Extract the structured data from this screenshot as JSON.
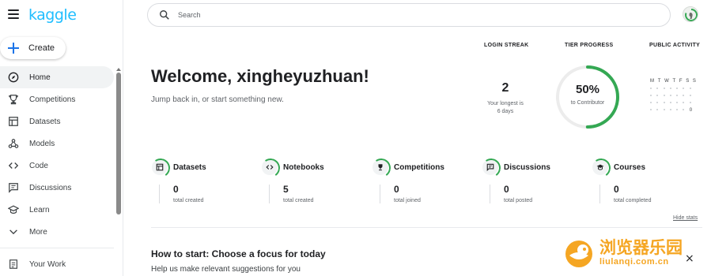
{
  "brand": {
    "logo_text": "kaggle",
    "accent": "#20beff"
  },
  "sidebar": {
    "create_label": "Create",
    "items": [
      {
        "label": "Home",
        "icon": "compass-icon",
        "active": true
      },
      {
        "label": "Competitions",
        "icon": "trophy-icon"
      },
      {
        "label": "Datasets",
        "icon": "table-icon"
      },
      {
        "label": "Models",
        "icon": "models-icon"
      },
      {
        "label": "Code",
        "icon": "code-icon"
      },
      {
        "label": "Discussions",
        "icon": "discussion-icon"
      },
      {
        "label": "Learn",
        "icon": "school-icon"
      },
      {
        "label": "More",
        "icon": "chevron-down-icon"
      }
    ],
    "your_work_label": "Your Work"
  },
  "search": {
    "placeholder": "Search"
  },
  "welcome": {
    "title": "Welcome, xingheyuzhuan!",
    "subtitle": "Jump back in, or start something new."
  },
  "stats": {
    "login_streak": {
      "heading": "LOGIN STREAK",
      "value": "2",
      "sub_line1": "Your longest is",
      "sub_line2": "6 days"
    },
    "tier_progress": {
      "heading": "TIER PROGRESS",
      "percent_label": "50%",
      "progress": 0.5,
      "sub": "to Contributor",
      "color": "#34a853"
    },
    "public_activity": {
      "heading": "PUBLIC ACTIVITY",
      "days": [
        "M",
        "T",
        "W",
        "T",
        "F",
        "S",
        "S"
      ],
      "zero": "0"
    }
  },
  "categories": [
    {
      "title": "Datasets",
      "value": "0",
      "sub": "total created",
      "icon": "table-icon"
    },
    {
      "title": "Notebooks",
      "value": "5",
      "sub": "total created",
      "icon": "code-icon"
    },
    {
      "title": "Competitions",
      "value": "0",
      "sub": "total joined",
      "icon": "trophy-icon"
    },
    {
      "title": "Discussions",
      "value": "0",
      "sub": "total posted",
      "icon": "discussion-icon"
    },
    {
      "title": "Courses",
      "value": "0",
      "sub": "total completed",
      "icon": "school-icon"
    }
  ],
  "hide_stats_label": "Hide stats",
  "how_to_start": {
    "title": "How to start: Choose a focus for today",
    "subtitle": "Help us make relevant suggestions for you"
  },
  "close_label": "×",
  "watermark": {
    "cn": "浏览器乐园",
    "url": "liulanqi.com.cn",
    "color": "#f5a623"
  }
}
